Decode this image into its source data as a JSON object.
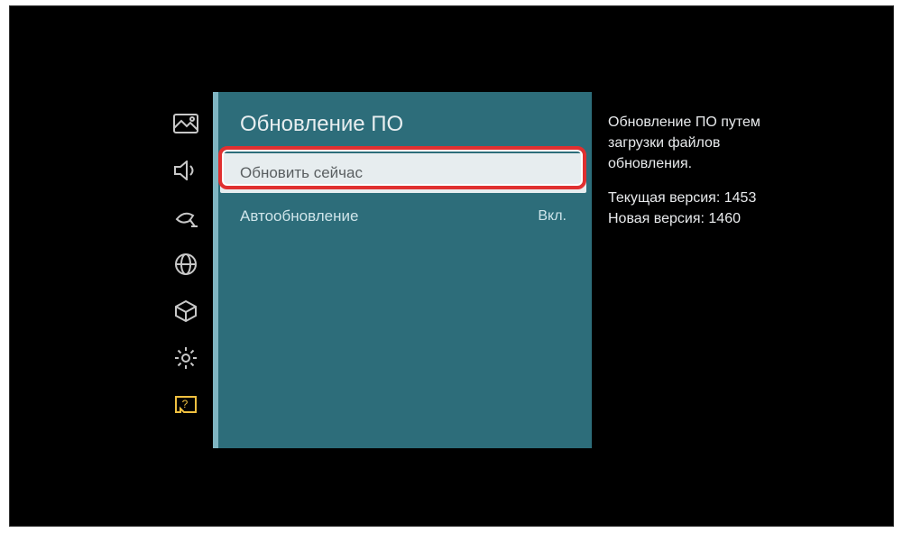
{
  "page_title": "Обновление ПО",
  "menu": {
    "update_now": "Обновить сейчас",
    "auto_update_label": "Автообновление",
    "auto_update_value": "Вкл."
  },
  "description": {
    "line1": "Обновление ПО путем",
    "line2": "загрузки файлов",
    "line3": "обновления.",
    "current_version_label": "Текущая версия:",
    "current_version_value": "1453",
    "new_version_label": "Новая версия:",
    "new_version_value": "1460"
  },
  "sidebar_icons": [
    "picture",
    "sound",
    "broadcast",
    "network",
    "system",
    "settings",
    "support"
  ]
}
